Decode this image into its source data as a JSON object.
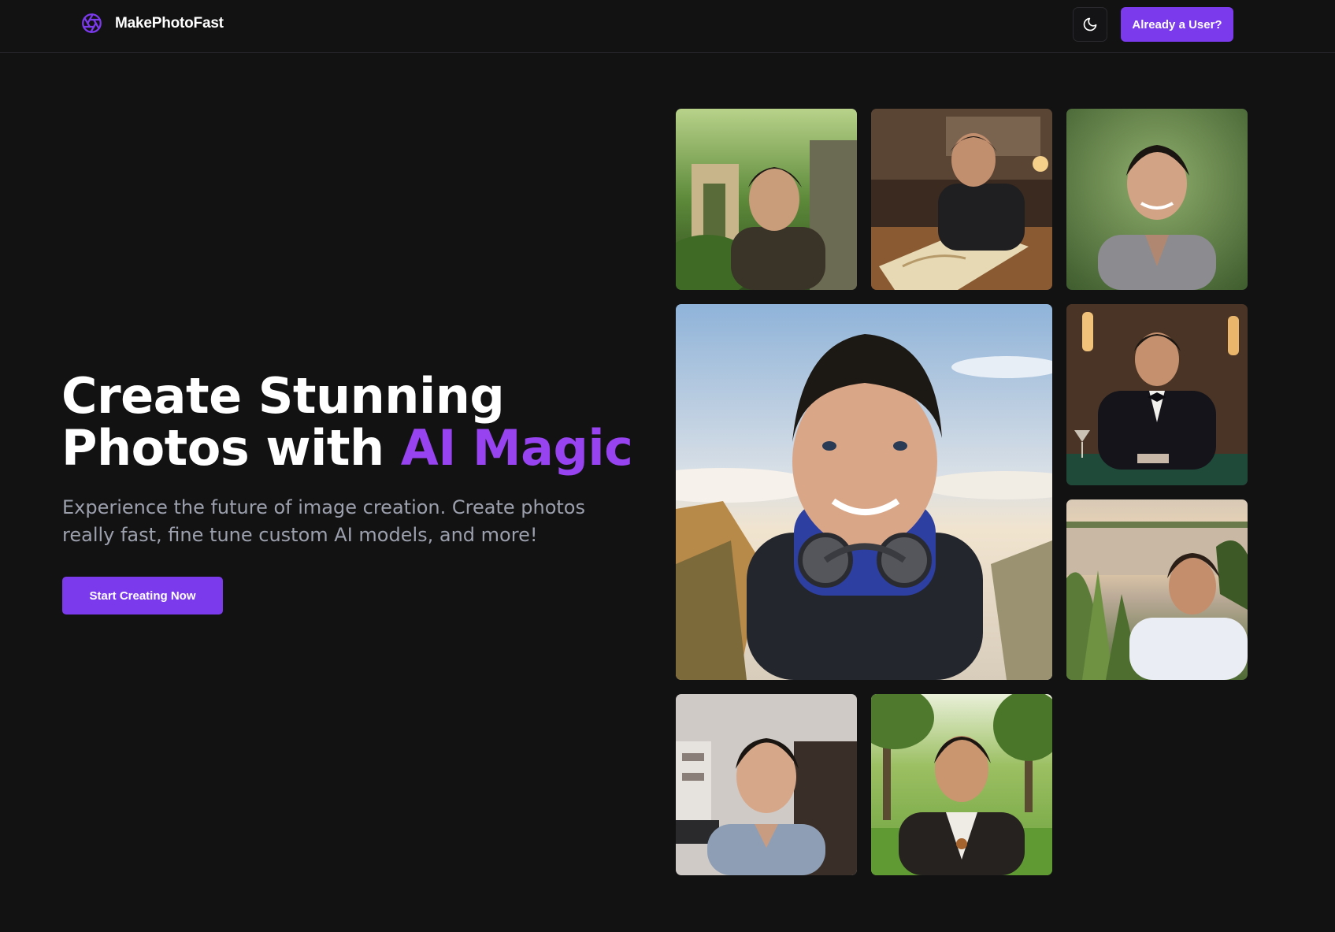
{
  "header": {
    "brand_name": "MakePhotoFast",
    "logo_icon": "aperture-icon",
    "theme_toggle_icon": "moon-icon",
    "login_label": "Already a User?"
  },
  "hero": {
    "headline_line1": "Create Stunning",
    "headline_line2_prefix": "Photos with ",
    "headline_accent": "AI Magic",
    "subtext": "Experience the future of image creation. Create photos really fast, fine tune custom AI models, and more!",
    "cta_label": "Start Creating Now"
  },
  "colors": {
    "accent": "#7c3aed",
    "accent_text": "#9743f0",
    "background": "#121213",
    "muted_text": "#9ca0ad"
  },
  "gallery": [
    {
      "scene": "forest-ruins"
    },
    {
      "scene": "desk-with-map"
    },
    {
      "scene": "garden-portrait"
    },
    {
      "scene": "mountain-selfie"
    },
    {
      "scene": "casino-tuxedo"
    },
    {
      "scene": "lakeside-sunset"
    },
    {
      "scene": "indoor-selfie"
    },
    {
      "scene": "park-leather-jacket"
    }
  ]
}
